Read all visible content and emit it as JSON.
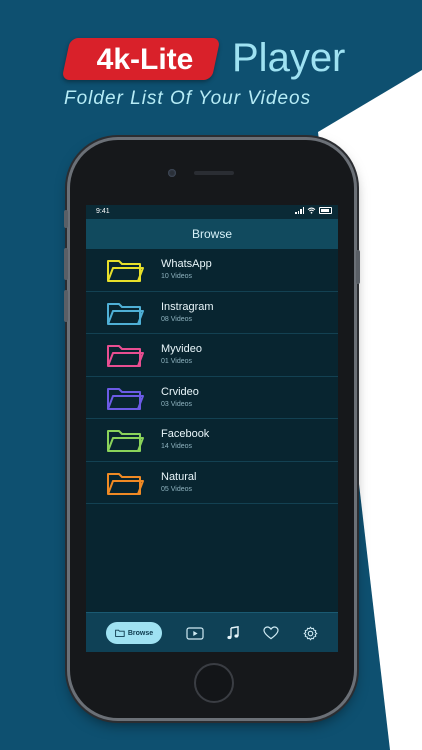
{
  "header": {
    "badge": "4k-Lite",
    "title": "Player",
    "subtitle": "Folder List Of Your Videos"
  },
  "status_bar": {
    "time": "9:41"
  },
  "nav": {
    "title": "Browse"
  },
  "folders": [
    {
      "name": "WhatsApp",
      "count": "10 Videos",
      "color": "#e7e02a"
    },
    {
      "name": "Instragram",
      "count": "08 Videos",
      "color": "#4fb0d6"
    },
    {
      "name": "Myvideo",
      "count": "01 Videos",
      "color": "#e94e91"
    },
    {
      "name": "Crvideo",
      "count": "03 Videos",
      "color": "#6c5be6"
    },
    {
      "name": "Facebook",
      "count": "14 Videos",
      "color": "#8ad35a"
    },
    {
      "name": "Natural",
      "count": "05 Videos",
      "color": "#f08a24"
    }
  ],
  "tabbar": {
    "browse_label": "Browse",
    "tabs": [
      "folder-icon",
      "play-video-icon",
      "music-note-icon",
      "heart-icon",
      "gear-icon"
    ]
  },
  "colors": {
    "background": "#0e5070",
    "accent": "#9fe2f2",
    "badge": "#d9212a"
  }
}
